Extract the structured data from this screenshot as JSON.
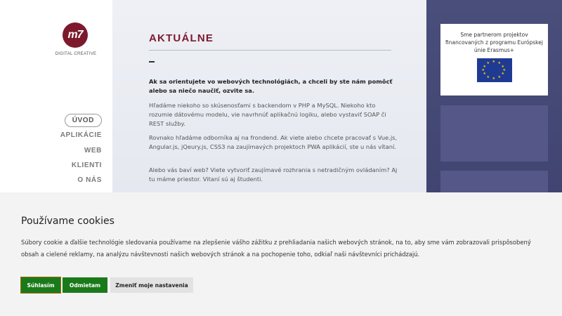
{
  "logo": {
    "mark": "m7",
    "tagline": "DIGITAL CREATIVE"
  },
  "nav": {
    "items": [
      {
        "label": "ÚVOD"
      },
      {
        "label": "APLIKÁCIE"
      },
      {
        "label": "WEB"
      },
      {
        "label": "KLIENTI"
      },
      {
        "label": "O NÁS"
      }
    ]
  },
  "main": {
    "title": "AKTUÁLNE",
    "lead": "Ak sa orientujete vo webových technológiách, a chceli by ste nám pomôcť alebo sa niečo naučiť, ozvite sa.",
    "p1": "Hľadáme niekoho so skúsenosťami s backendom v PHP a MySQL. Niekoho kto rozumie dátovému modelu, vie navrhnúť aplikačnú logiku, alebo vystaviť SOAP či REST služby.",
    "p2": "Rovnako hľadáme odborníka aj na frondend. Ak viete alebo chcete pracovať s Vue.js, Angular.js, jQeury.js, CSS3 na zaujímavých projektoch PWA aplikácií, ste u nás vítaní.",
    "p3": "Alebo vás baví web? Viete vytvoriť zaujímavé rozhrania s netradičným ovládaním? Aj tu máme priestor. Vitaní sú aj študenti."
  },
  "partner": {
    "text": "Sme partnerom projektov financovaných z programu Európskej únie Erasmus+",
    "flag_icon": "eu-flag-icon",
    "colors": {
      "flag_blue": "#1f3a93",
      "flag_stars": "#ffcc00"
    }
  },
  "cookie": {
    "title": "Používame cookies",
    "text": "Súbory cookie a ďalšie technológie sledovania používame na zlepšenie vášho zážitku z prehliadania našich webových stránok, na to, aby sme vám zobrazovali prispôsobený obsah a cielené reklamy, na analýzu návštevnosti našich webových stránok a na pochopenie toho, odkiaľ naši návštevníci prichádzajú.",
    "accept_label": "Súhlasím",
    "reject_label": "Odmietam",
    "settings_label": "Zmeniť moje nastavenia"
  },
  "colors": {
    "brand": "#7c1a2c",
    "accept_bg": "#1a7a1a",
    "right_panel": "#4a4e7a"
  }
}
